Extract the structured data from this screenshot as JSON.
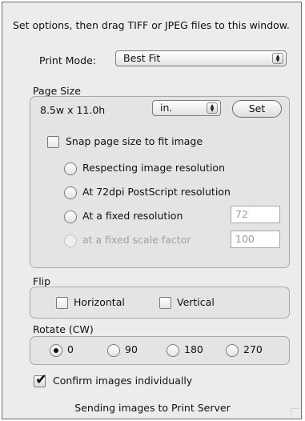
{
  "instructions": "Set options, then drag TIFF or JPEG files to this window.",
  "print_mode": {
    "label": "Print Mode:",
    "value": "Best Fit"
  },
  "page_size": {
    "group_label": "Page Size",
    "dimensions": "8.5w x 11.0h",
    "units": "in.",
    "set_button": "Set",
    "snap_label": "Snap page size to fit image",
    "snap_checked": false,
    "options": [
      {
        "label": "Respecting image resolution",
        "selected": false,
        "enabled": true
      },
      {
        "label": "At 72dpi PostScript resolution",
        "selected": false,
        "enabled": true
      },
      {
        "label": "At a fixed resolution",
        "selected": false,
        "enabled": true,
        "value": "72"
      },
      {
        "label": "at a fixed scale factor",
        "selected": false,
        "enabled": false,
        "value": "100"
      }
    ]
  },
  "flip": {
    "group_label": "Flip",
    "horizontal": "Horizontal",
    "vertical": "Vertical",
    "horizontal_checked": false,
    "vertical_checked": false
  },
  "rotate": {
    "group_label": "Rotate (CW)",
    "options": [
      "0",
      "90",
      "180",
      "270"
    ],
    "selected": "0"
  },
  "confirm": {
    "label": "Confirm images individually",
    "checked": true
  },
  "status": "Sending images to Print Server"
}
